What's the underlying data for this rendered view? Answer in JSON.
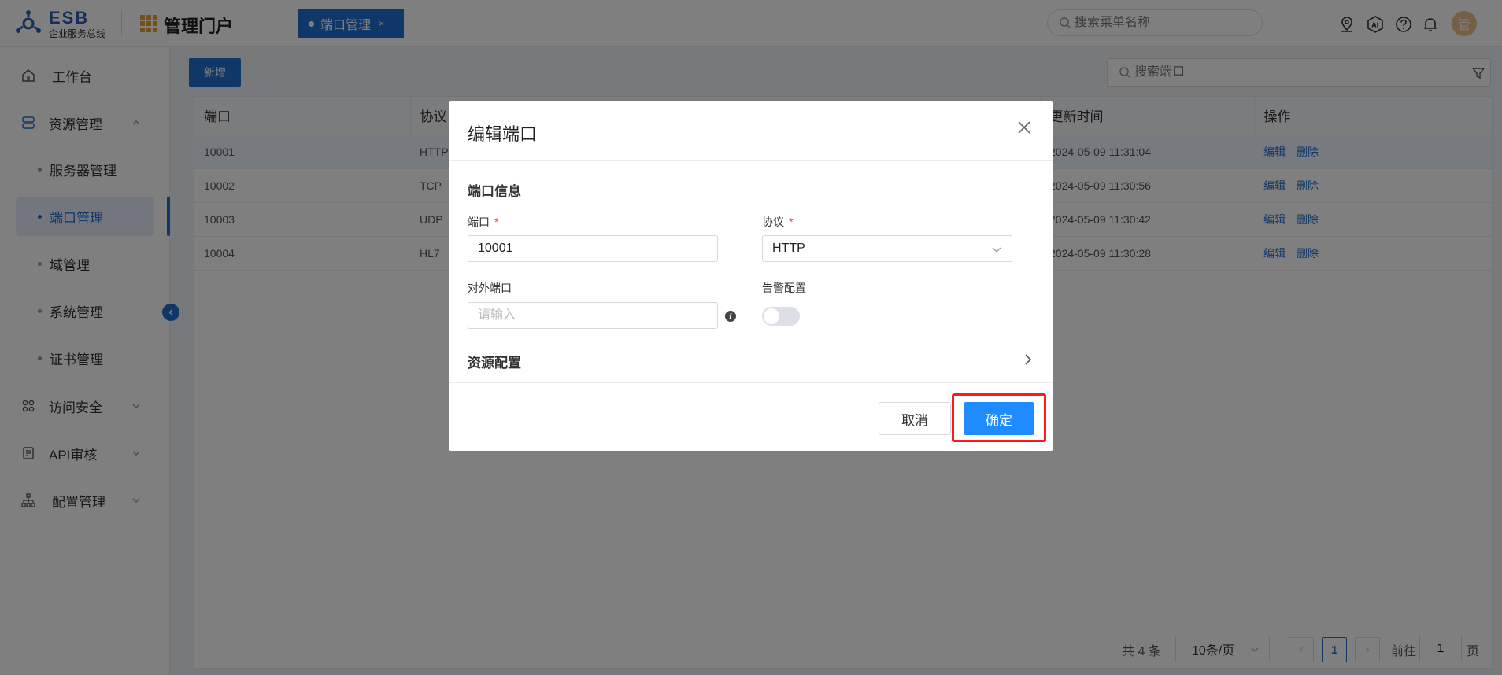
{
  "header": {
    "logo_text": "ESB",
    "logo_subtitle": "企业服务总线",
    "portal_title": "管理门户",
    "tab": {
      "label": "端口管理",
      "close": "×"
    },
    "menu_search_placeholder": "搜索菜单名称",
    "icons": [
      "location-icon",
      "ai-icon",
      "help-icon",
      "bell-icon"
    ],
    "avatar_text": "管"
  },
  "sidebar": {
    "workbench": "工作台",
    "resource": "资源管理",
    "resource_items": [
      "服务器管理",
      "端口管理",
      "域管理",
      "系统管理",
      "证书管理"
    ],
    "security": "访问安全",
    "api_audit": "API审核",
    "config": "配置管理"
  },
  "main": {
    "add_button": "新增",
    "port_search_placeholder": "搜索端口",
    "table": {
      "columns": [
        "端口",
        "协议",
        "更新时间",
        "操作"
      ],
      "rows": [
        {
          "port": "10001",
          "protocol": "HTTP",
          "updated": "2024-05-09 11:31:04"
        },
        {
          "port": "10002",
          "protocol": "TCP",
          "updated": "2024-05-09 11:30:56"
        },
        {
          "port": "10003",
          "protocol": "UDP",
          "updated": "2024-05-09 11:30:42"
        },
        {
          "port": "10004",
          "protocol": "HL7",
          "updated": "2024-05-09 11:30:28"
        }
      ],
      "op_edit": "编辑",
      "op_delete": "删除"
    },
    "pager": {
      "total": "共 4 条",
      "page_size": "10条/页",
      "current": "1",
      "goto": "前往",
      "goto_value": "1",
      "page": "页"
    }
  },
  "modal": {
    "title": "编辑端口",
    "section_port_info": "端口信息",
    "port_label": "端口",
    "port_value": "10001",
    "protocol_label": "协议",
    "protocol_value": "HTTP",
    "external_port_label": "对外端口",
    "external_port_placeholder": "请输入",
    "alarm_label": "告警配置",
    "section_resource": "资源配置",
    "required_mark": "*",
    "cancel": "取消",
    "confirm": "确定"
  },
  "colors": {
    "primary": "#1e6fd0",
    "confirm": "#1e8cff",
    "highlight": "#ff1a1a"
  }
}
